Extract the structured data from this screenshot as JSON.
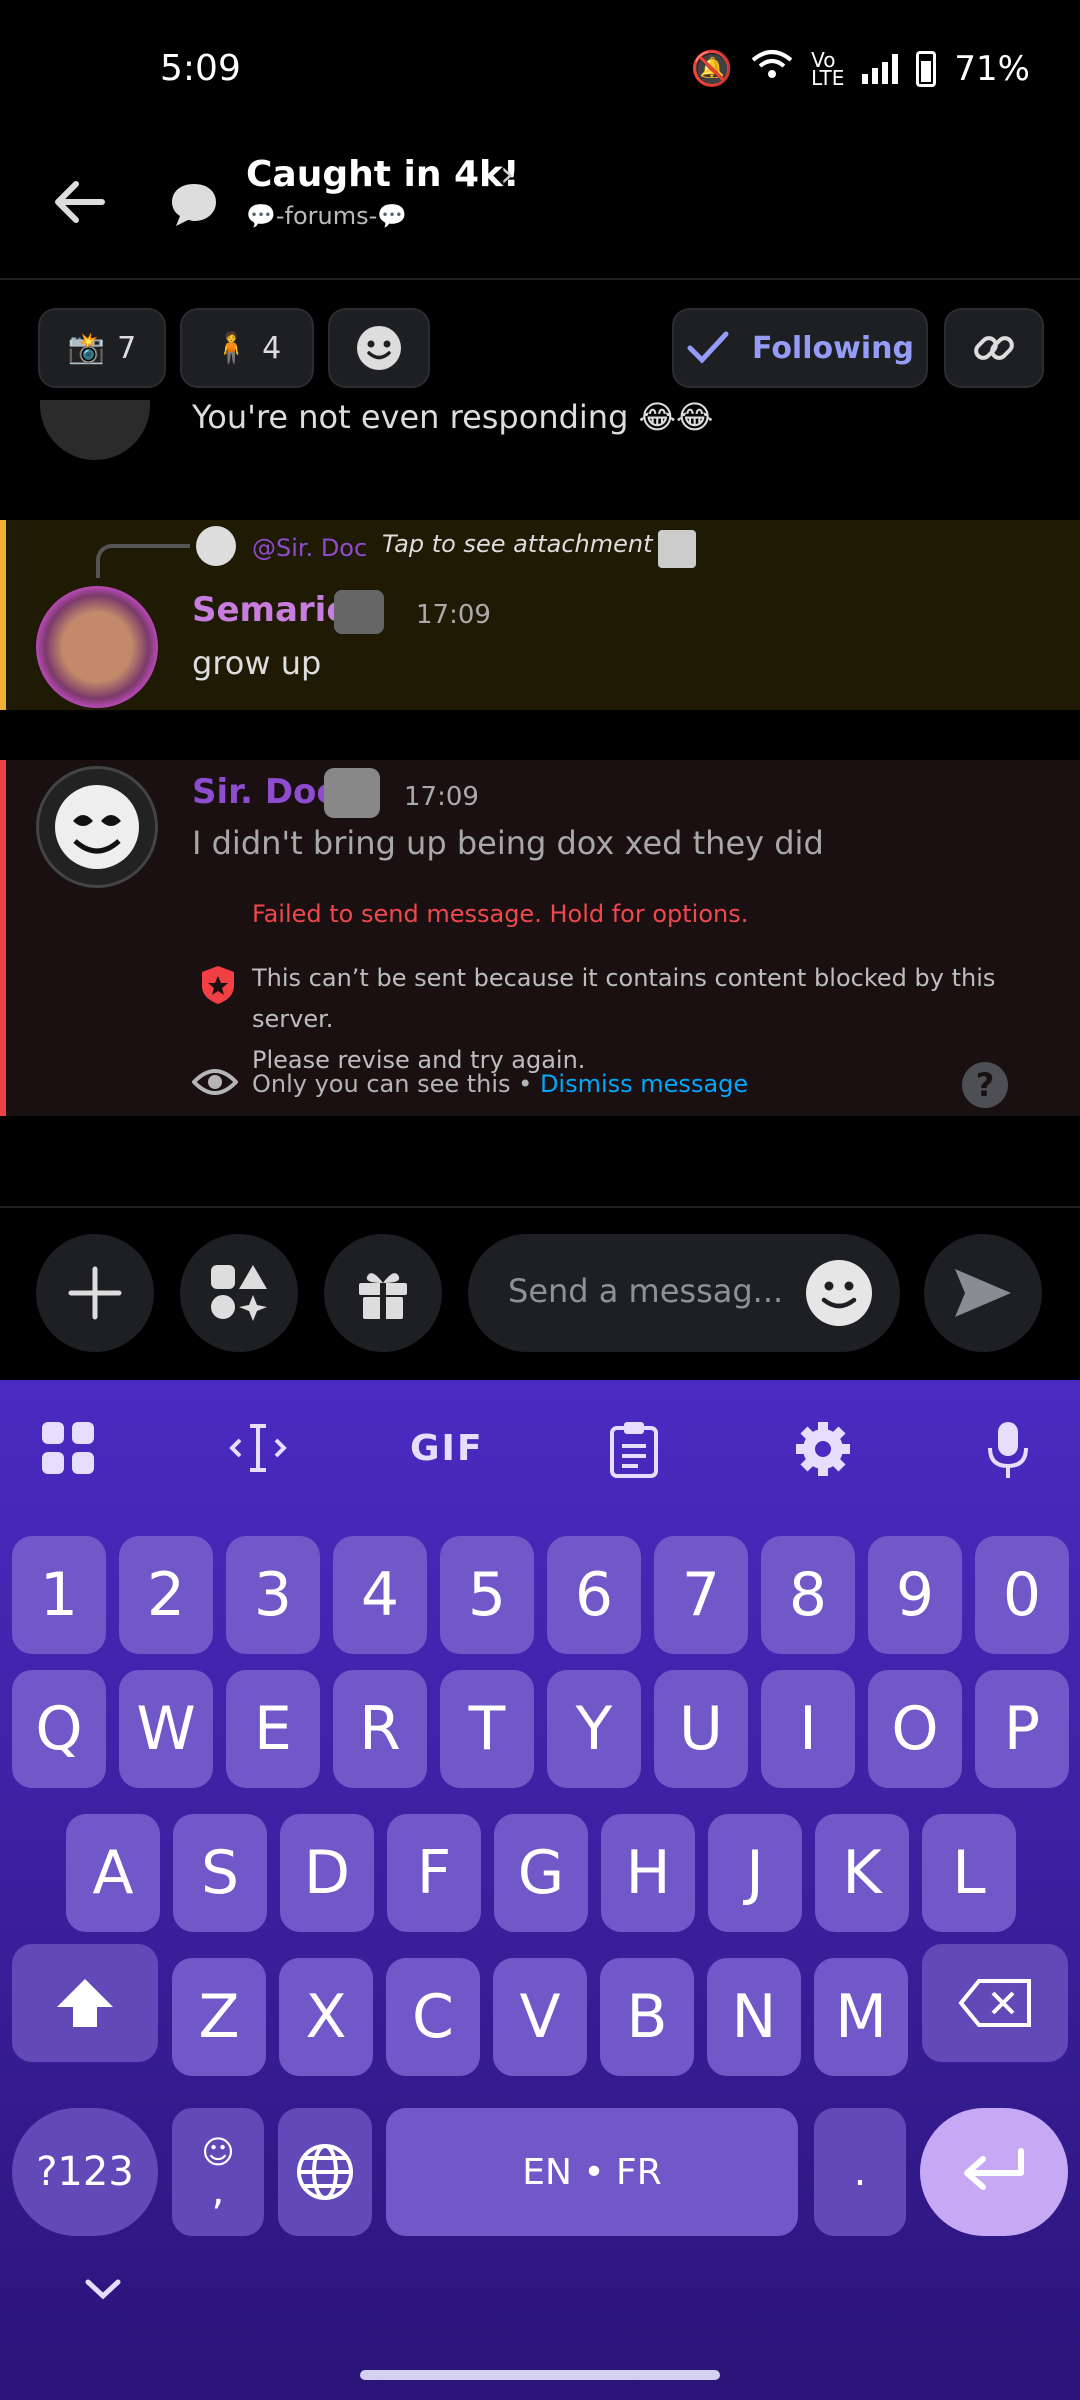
{
  "status_bar": {
    "time": "5:09",
    "battery": "71%"
  },
  "header": {
    "title": "Caught in 4k!",
    "subtitle": "💬-forums-💬"
  },
  "chips": {
    "camera_count": "7",
    "person_count": "4",
    "following_label": "Following"
  },
  "messages": {
    "partial_text": "You're not even responding 😂😂",
    "semarie": {
      "reply_to": "@Sir. Doc",
      "reply_hint": "Tap to see attachment",
      "author": "Semarie",
      "time": "17:09",
      "text": "grow up"
    },
    "sirdoc": {
      "author": "Sir. Doc",
      "time": "17:09",
      "text": "I didn't bring up being dox xed they did",
      "error": "Failed to send message. Hold for options.",
      "blocked_line1": "This can’t be sent because it contains content blocked by this server.",
      "blocked_line2": "Please revise and try again.",
      "only_you": "Only you can see this •",
      "dismiss": "Dismiss message"
    }
  },
  "composer": {
    "placeholder": "Send a messag..."
  },
  "keyboard": {
    "tools": [
      "grid-icon",
      "cursor-icon",
      "gif",
      "clipboard-icon",
      "settings-icon",
      "mic-icon"
    ],
    "gif_label": "GIF",
    "row_numbers": [
      "1",
      "2",
      "3",
      "4",
      "5",
      "6",
      "7",
      "8",
      "9",
      "0"
    ],
    "row1": [
      "Q",
      "W",
      "E",
      "R",
      "T",
      "Y",
      "U",
      "I",
      "O",
      "P"
    ],
    "row2": [
      "A",
      "S",
      "D",
      "F",
      "G",
      "H",
      "J",
      "K",
      "L"
    ],
    "row3": [
      "Z",
      "X",
      "C",
      "V",
      "B",
      "N",
      "M"
    ],
    "sym_label": "?123",
    "comma": ",",
    "space_label": "EN • FR",
    "period": "."
  },
  "colors": {
    "keyboard_bg": "#4a2bc2",
    "key": "#7058c9",
    "semarie_name": "#c77dde",
    "sirdoc_name": "#8e4ccf",
    "error": "#f0484c",
    "link": "#00a8fc",
    "following": "#949cf7"
  }
}
